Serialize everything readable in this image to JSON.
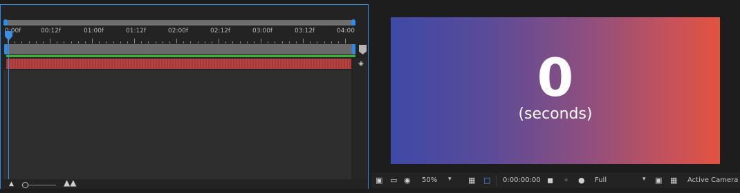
{
  "timeline": {
    "ruler_labels": [
      "0:00f",
      "00:12f",
      "01:00f",
      "01:12f",
      "02:00f",
      "02:12f",
      "03:00f",
      "03:12f",
      "04:00"
    ],
    "icons": {
      "layer_side": "mask-diamond-icon",
      "zoom_out": "mountain-small-icon",
      "zoom_in": "mountain-large-icon"
    }
  },
  "viewer": {
    "composition_text": {
      "number": "0",
      "unit": "(seconds)"
    },
    "toolbar": {
      "zoom": "50%",
      "timecode": "0:00:00:00",
      "resolution": "Full",
      "camera": "Active Camera"
    }
  },
  "colors": {
    "accent": "#2d8ceb",
    "layer_bar": "#a83838",
    "work_area_line": "#3bb03b",
    "gradient_start": "#3e4aa6",
    "gradient_end": "#e3533f"
  }
}
